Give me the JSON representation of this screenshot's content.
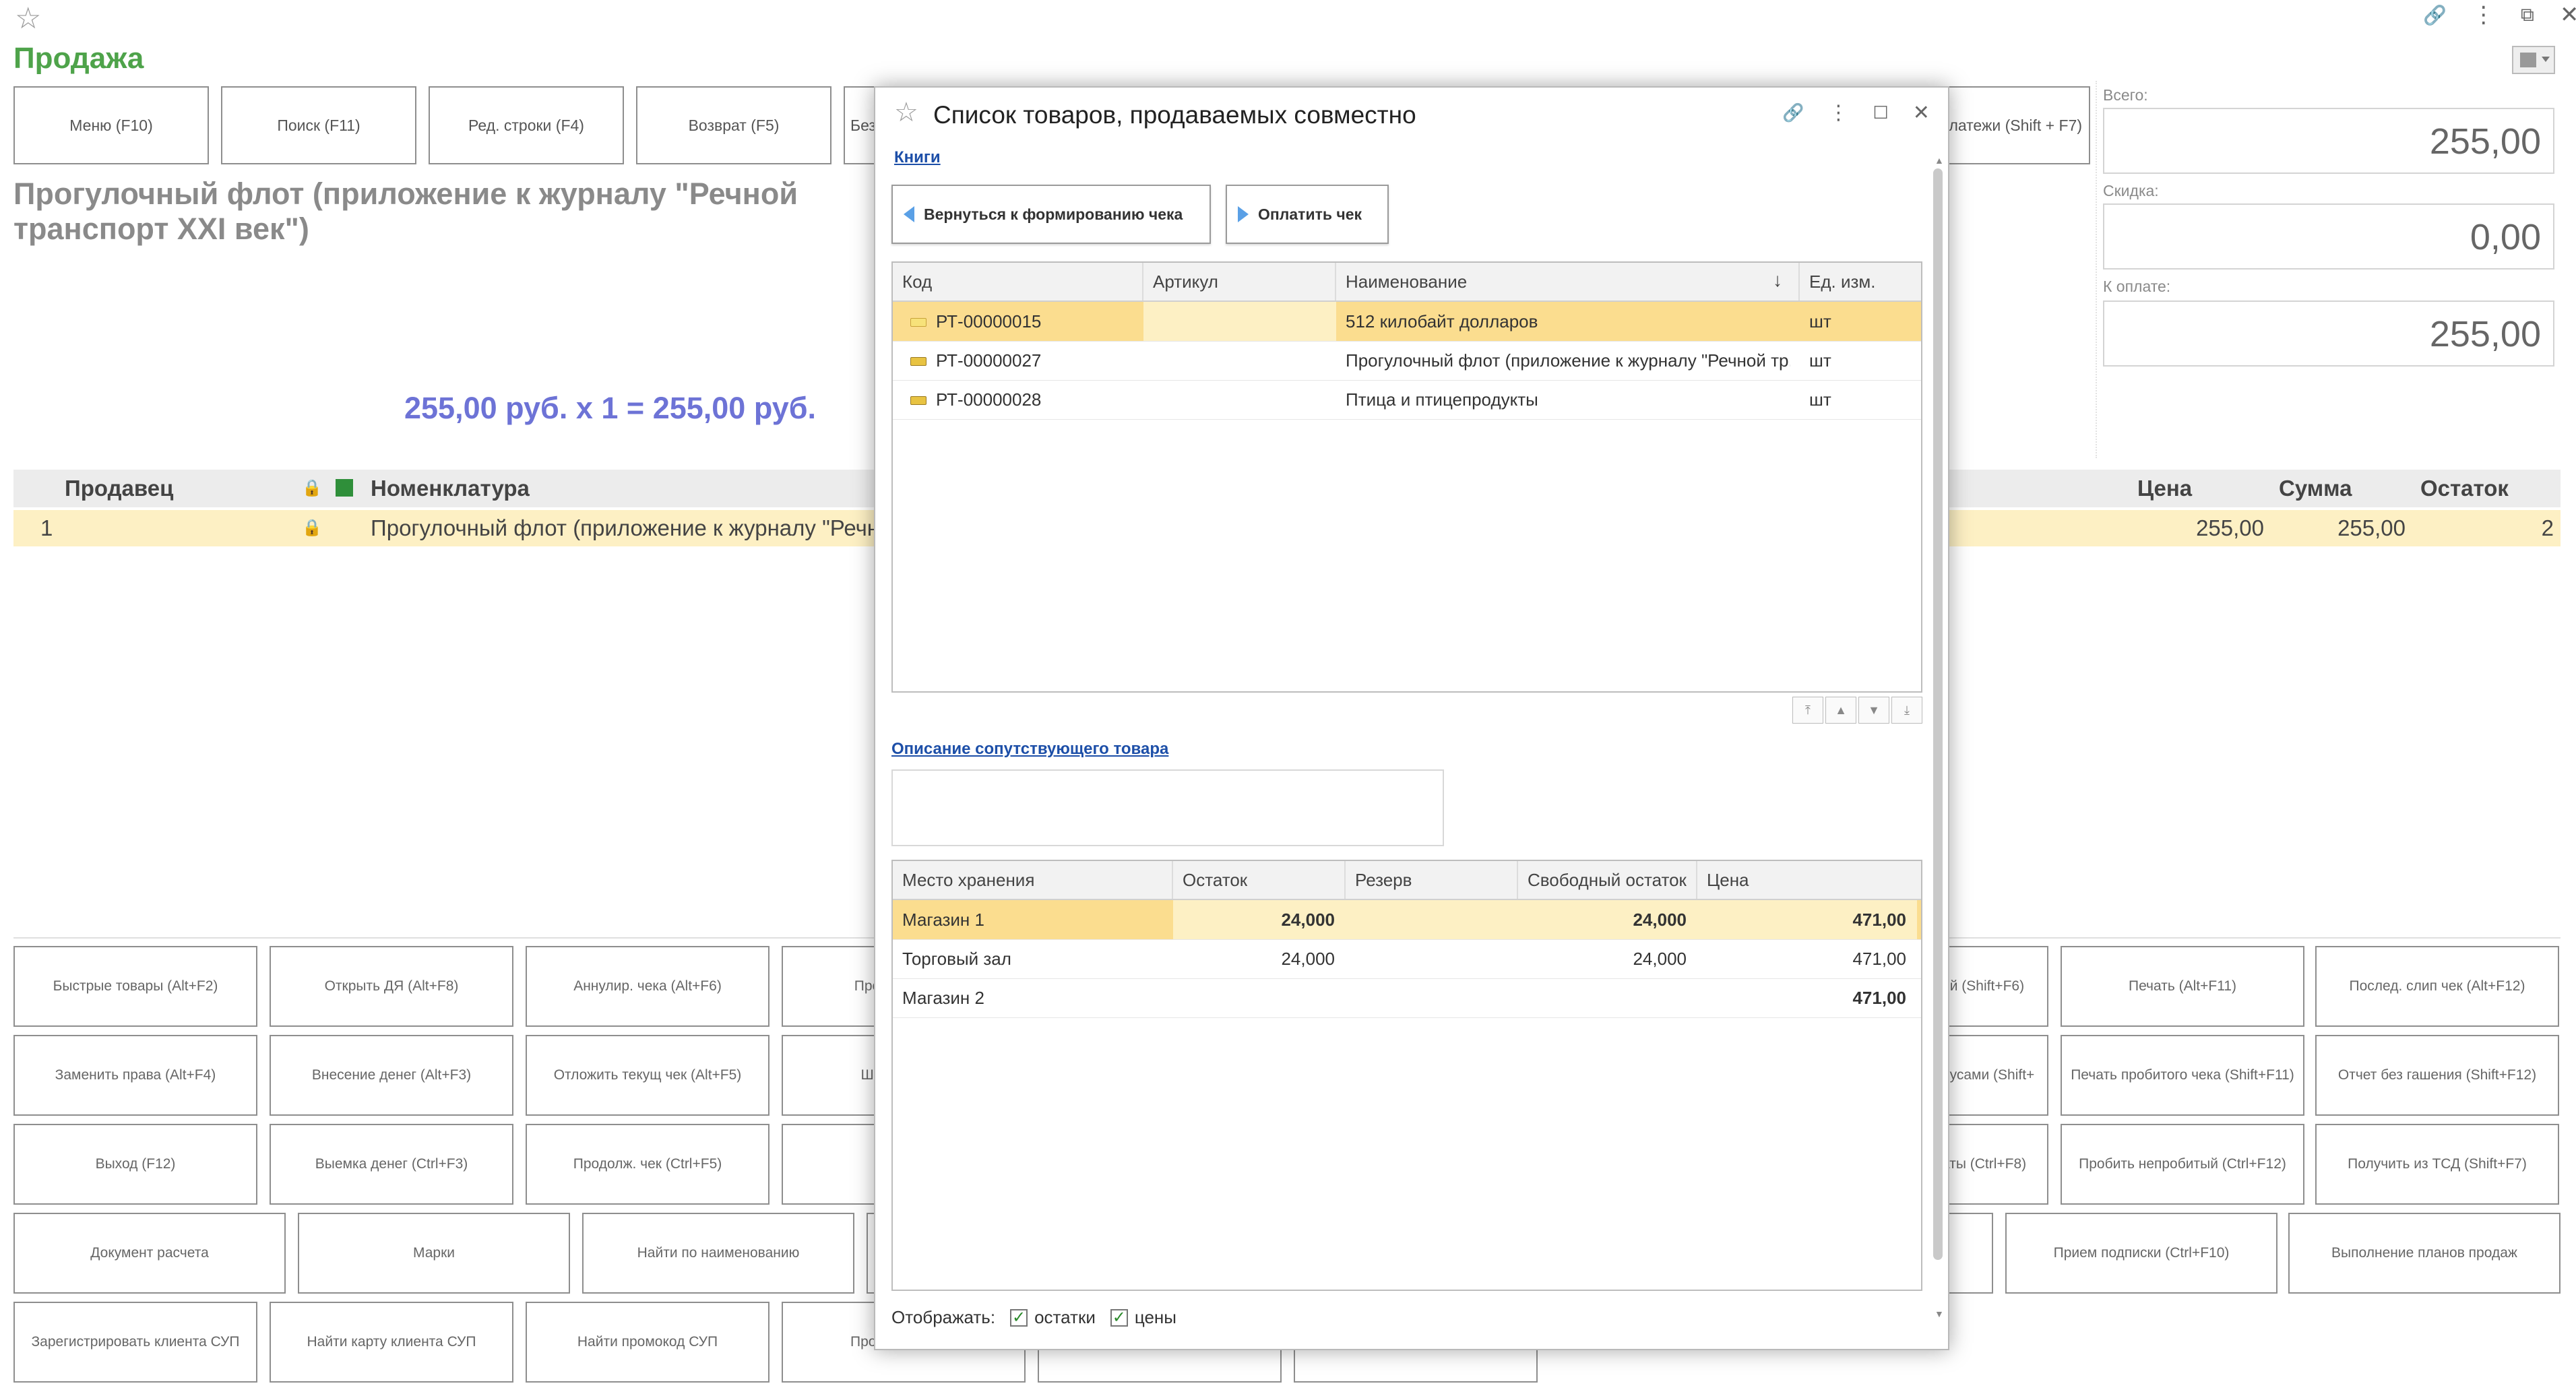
{
  "app": {
    "title": "Продажа",
    "icons": {
      "favorite": "☆",
      "link": "🔗",
      "more": "⋮",
      "restore": "⧉",
      "close": "✕"
    }
  },
  "toolbar": [
    {
      "label": "Меню (F10)"
    },
    {
      "label": "Поиск (F11)"
    },
    {
      "label": "Ред. строки (F4)"
    },
    {
      "label": "Возврат (F5)"
    },
    {
      "label": "Без"
    },
    {
      "label": "платежи (Shift + F7)"
    }
  ],
  "product": {
    "name": "Прогулочный флот (приложение к журналу \"Речной транспорт XXI век\")",
    "price_line": "255,00 руб. х 1  = 255,00 руб."
  },
  "totals": {
    "total_label": "Всего:",
    "total_value": "255,00",
    "discount_label": "Скидка:",
    "discount_value": "0,00",
    "pay_label": "К оплате:",
    "pay_value": "255,00"
  },
  "grid": {
    "headers": {
      "seller": "Продавец",
      "nomenclature": "Номенклатура",
      "price": "Цена",
      "sum": "Сумма",
      "stock": "Остаток"
    },
    "rows": [
      {
        "num": "1",
        "name": "Прогулочный флот (приложение к журналу \"Речн",
        "price": "255,00",
        "sum": "255,00",
        "stock": "2"
      }
    ]
  },
  "hotkeys": {
    "row1_left": [
      "Быстрые товары (Alt+F2)",
      "Открыть ДЯ (Alt+F8)",
      "Аннулир. чека (Alt+F6)",
      "Прод"
    ],
    "row1_right": [
      "ий (Shift+F6)",
      "Печать (Alt+F11)",
      "Послед. слип чек (Alt+F12)"
    ],
    "row2_left": [
      "Заменить права (Alt+F4)",
      "Внесение денег (Alt+F3)",
      "Отложить текущ чек (Alt+F5)",
      "Штр"
    ],
    "row2_right": [
      "нусами (Shift+",
      "Печать пробитого чека (Shift+F11)",
      "Отчет без гашения (Shift+F12)"
    ],
    "row3_left": [
      "Выход (F12)",
      "Выемка денег (Ctrl+F3)",
      "Продолж. чек (Ctrl+F5)",
      "В"
    ],
    "row3_right": [
      "аты (Ctrl+F8)",
      "Пробить непробитый (Ctrl+F12)",
      "Получить из ТСД (Shift+F7)"
    ],
    "row4_left": [
      "Документ расчета",
      "Марки",
      "Найти по наименованию"
    ],
    "row4_right": [
      "Прием подписки (Ctrl+F10)",
      "Выполнение планов продаж"
    ],
    "row5_left": [
      "Зарегистрировать клиента СУП",
      "Найти карту клиента СУП",
      "Найти промокод СУП",
      "Про"
    ]
  },
  "dialog": {
    "title": "Список товаров, продаваемых совместно",
    "group_link": "Книги",
    "back_button": "Вернуться к формированию чека",
    "pay_button": "Оплатить чек",
    "table1": {
      "headers": {
        "code": "Код",
        "article": "Артикул",
        "name": "Наименование",
        "unit": "Ед. изм."
      },
      "rows": [
        {
          "code": "РТ-00000015",
          "article": "",
          "name": "512 килобайт долларов",
          "unit": "шт"
        },
        {
          "code": "РТ-00000027",
          "article": "",
          "name": "Прогулочный флот (приложение к журналу \"Речной тр...",
          "unit": "шт"
        },
        {
          "code": "РТ-00000028",
          "article": "",
          "name": "Птица и птицепродукты",
          "unit": "шт"
        }
      ]
    },
    "desc_link": "Описание сопутствующего товара",
    "table2": {
      "headers": {
        "place": "Место хранения",
        "stock": "Остаток",
        "reserve": "Резерв",
        "free": "Свободный остаток",
        "price": "Цена"
      },
      "rows": [
        {
          "place": "Магазин 1",
          "stock": "24,000",
          "reserve": "",
          "free": "24,000",
          "price": "471,00"
        },
        {
          "place": "Торговый зал",
          "stock": "24,000",
          "reserve": "",
          "free": "24,000",
          "price": "471,00"
        },
        {
          "place": "Магазин 2",
          "stock": "",
          "reserve": "",
          "free": "",
          "price": "471,00"
        }
      ]
    },
    "footer": {
      "label": "Отображать:",
      "cb1": "остатки",
      "cb2": "цены"
    },
    "colors": {
      "selected_row": "#fbdd8f",
      "selected_cell": "#fdf0c4",
      "arrow": "#5aa0e6"
    }
  }
}
